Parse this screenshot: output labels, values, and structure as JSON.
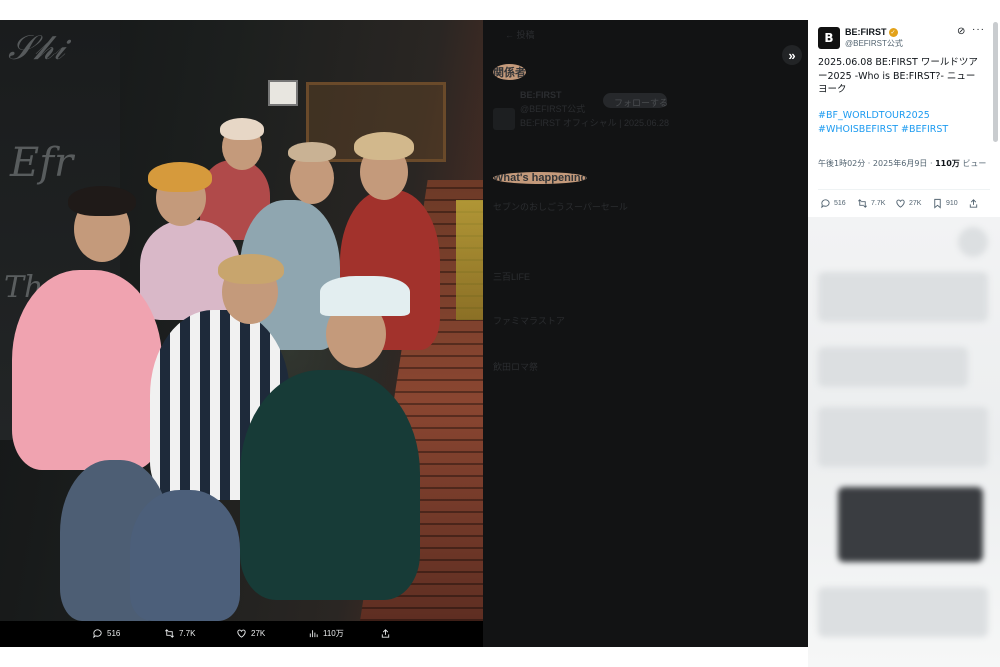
{
  "viewer": {
    "collapse_icon": "»",
    "actions": {
      "replies": "516",
      "retweets": "7.7K",
      "likes": "27K",
      "views": "110万"
    },
    "ghost": {
      "header": "関係者",
      "account_name": "BE:FIRST",
      "account_handle": "@BEFIRST公式",
      "follow": "フォローする",
      "bio": "BE:FIRST オフィシャル | 2025.06.28",
      "happening": "What's happening",
      "trend1": "セブンのおしごうスーパーセール",
      "trend2": "三百LIFE",
      "trend3": "ファミマラストア",
      "trend4": "飲田ロマ祭"
    }
  },
  "tweet": {
    "avatar_glyph": "B",
    "author_name": "BE:FIRST",
    "author_handle": "@BEFIRST公式",
    "text": "2025.06.08 BE:FIRST ワールドツアー2025 -Who is BE:FIRST?- ニューヨーク",
    "hashtags": "#BF_WORLDTOUR2025 #WHOISBEFIRST #BEFIRST",
    "meta_time": "午後1時02分 · 2025年6月9日 · ",
    "meta_views": "110万",
    "meta_views_label": " ビュー",
    "actions": {
      "replies": "516",
      "retweets": "7.7K",
      "likes": "27K",
      "bookmarks": "910"
    }
  },
  "colors": {
    "link": "#1d9bf0",
    "verified": "#e3a21a",
    "viewer_bg": "#0b0b0c"
  },
  "icons": [
    "reply-icon",
    "retweet-icon",
    "like-icon",
    "views-icon",
    "share-icon",
    "bookmark-icon",
    "grok-icon",
    "more-icon",
    "collapse-icon",
    "verified-icon"
  ]
}
